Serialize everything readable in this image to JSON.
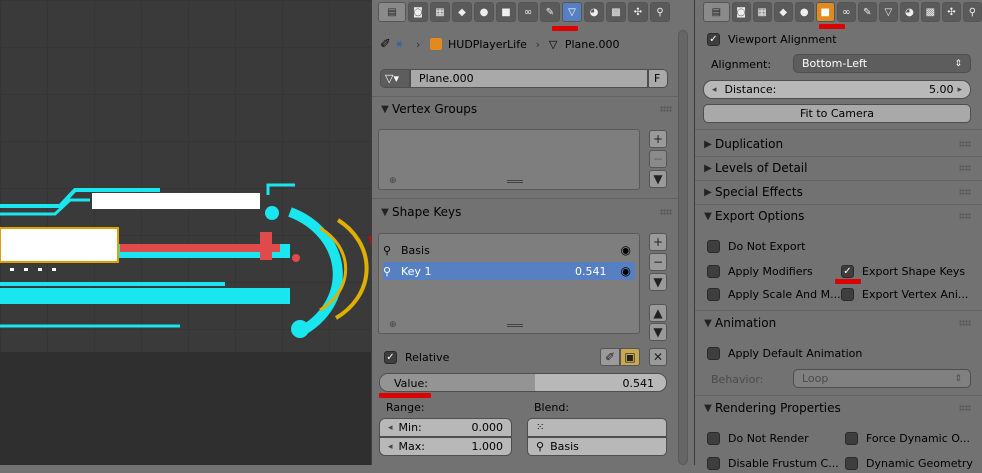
{
  "viewport": {},
  "middle": {
    "breadcrumb": {
      "object": "HUDPlayerLife",
      "mesh": "Plane.000"
    },
    "mesh_field": {
      "value": "Plane.000",
      "fake_user": "F"
    },
    "sections": {
      "vertex_groups": "Vertex Groups",
      "shape_keys": "Shape Keys"
    },
    "shape_keys": [
      {
        "name": "Basis",
        "value": ""
      },
      {
        "name": "Key 1",
        "value": "0.541"
      }
    ],
    "relative_label": "Relative",
    "value_field": {
      "label": "Value:",
      "value": "0.541",
      "fraction": 0.541
    },
    "range_label": "Range:",
    "min": {
      "label": "Min:",
      "value": "0.000"
    },
    "max": {
      "label": "Max:",
      "value": "1.000"
    },
    "blend_label": "Blend:",
    "relative_to": "Basis"
  },
  "right": {
    "viewport_alignment": "Viewport Alignment",
    "alignment_label": "Alignment:",
    "alignment_value": "Bottom-Left",
    "distance": {
      "label": "Distance:",
      "value": "5.00"
    },
    "fit_to_camera": "Fit to Camera",
    "collapsed_sections": [
      "Duplication",
      "Levels of Detail",
      "Special Effects"
    ],
    "export_options": {
      "title": "Export Options",
      "do_not_export": "Do Not Export",
      "apply_modifiers": "Apply Modifiers",
      "export_shape_keys": "Export Shape Keys",
      "apply_scale": "Apply Scale And M...",
      "export_vertex_anim": "Export Vertex Ani..."
    },
    "animation": {
      "title": "Animation",
      "apply_default": "Apply Default Animation",
      "behavior_label": "Behavior:",
      "behavior_value": "Loop"
    },
    "rendering": {
      "title": "Rendering Properties",
      "do_not_render": "Do Not Render",
      "force_dynamic": "Force Dynamic O...",
      "disable_frustum": "Disable Frustum C...",
      "dynamic_geometry": "Dynamic Geometry"
    }
  },
  "colors": {
    "selected": "#5680c2",
    "annotation": "#dd0000",
    "hud_cyan": "#19e6ee"
  }
}
